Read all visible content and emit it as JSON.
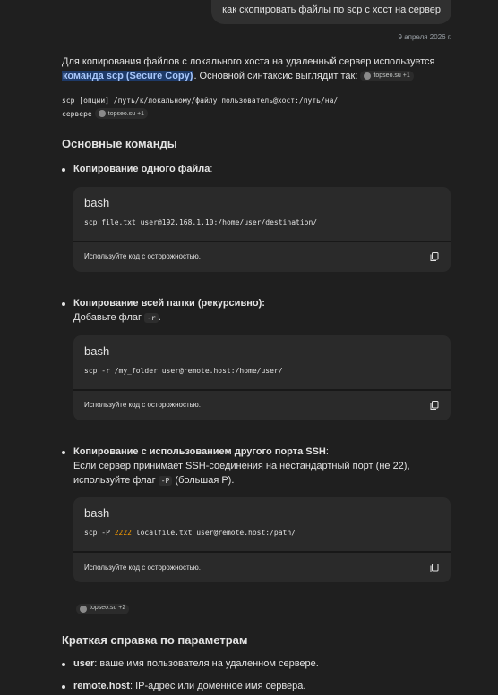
{
  "user_query": "как скопировать файлы по scp с хост на сервер",
  "date": "9 апреля 2026 г.",
  "intro": {
    "text_before": "Для копирования файлов с локального хоста на удаленный сервер используется ",
    "highlight": "команда scp (Secure Copy)",
    "text_after": ". Основной синтаксис выглядит так:",
    "source": "topseo.su +1"
  },
  "syntax": {
    "code_line1": "scp [опции] /путь/к/локальному/файлу пользователь@хост:/путь/на/",
    "code_line2": "сервере",
    "source": "topseo.su +1"
  },
  "section_title": "Основные команды",
  "commands": [
    {
      "title": "Копирование одного файла",
      "title_suffix": ":",
      "lang": "bash",
      "code": "scp file.txt user@192.168.1.10:/home/user/destination/",
      "caution": "Используйте код с осторожностью."
    },
    {
      "title": "Копирование всей папки (рекурсивно)",
      "title_suffix": ":",
      "desc_before": "Добавьте флаг ",
      "flag": "-r",
      "desc_after": ".",
      "lang": "bash",
      "code": "scp -r /my_folder user@remote.host:/home/user/",
      "caution": "Используйте код с осторожностью."
    },
    {
      "title": "Копирование с использованием другого порта SSH",
      "title_suffix": ":",
      "desc_line1": "Если сервер принимает SSH-соединения на нестандартный порт (не 22),",
      "desc_before": "используйте флаг ",
      "flag": "-P",
      "desc_after": " (большая P).",
      "lang": "bash",
      "code_before": "scp -P ",
      "code_num": "2222",
      "code_after": " localfile.txt user@remote.host:/path/",
      "caution": "Используйте код с осторожностью."
    }
  ],
  "refs_source": "topseo.su +2",
  "params_title": "Краткая справка по параметрам",
  "params": [
    {
      "name": "user",
      "desc": ": ваше имя пользователя на удаленном сервере."
    },
    {
      "name": "remote.host",
      "desc": ": IP-адрес или доменное имя сервера."
    }
  ]
}
